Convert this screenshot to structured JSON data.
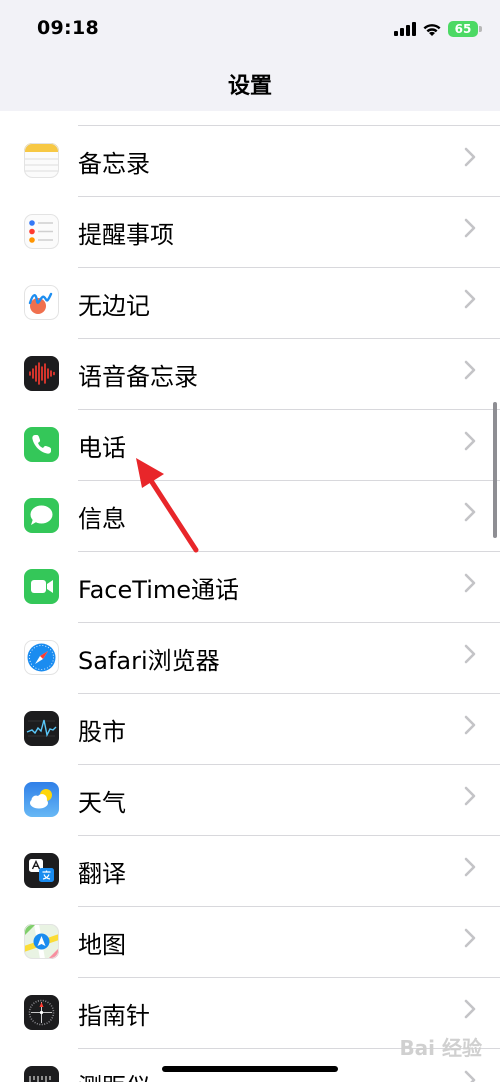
{
  "status": {
    "time": "09:18",
    "battery": "65"
  },
  "nav": {
    "title": "设置"
  },
  "items": [
    {
      "label": "备忘录",
      "icon": "notes-icon"
    },
    {
      "label": "提醒事项",
      "icon": "reminders-icon"
    },
    {
      "label": "无边记",
      "icon": "freeform-icon"
    },
    {
      "label": "语音备忘录",
      "icon": "voice-memos-icon"
    },
    {
      "label": "电话",
      "icon": "phone-icon"
    },
    {
      "label": "信息",
      "icon": "messages-icon"
    },
    {
      "label": "FaceTime通话",
      "icon": "facetime-icon"
    },
    {
      "label": "Safari浏览器",
      "icon": "safari-icon"
    },
    {
      "label": "股市",
      "icon": "stocks-icon"
    },
    {
      "label": "天气",
      "icon": "weather-icon"
    },
    {
      "label": "翻译",
      "icon": "translate-icon"
    },
    {
      "label": "地图",
      "icon": "maps-icon"
    },
    {
      "label": "指南针",
      "icon": "compass-icon"
    },
    {
      "label": "测距仪",
      "icon": "measure-icon"
    }
  ],
  "watermark": "Bai 经验",
  "colors": {
    "accent_arrow": "#e8262a",
    "chevron": "#c4c4c7",
    "phone_green": "#34c759"
  }
}
